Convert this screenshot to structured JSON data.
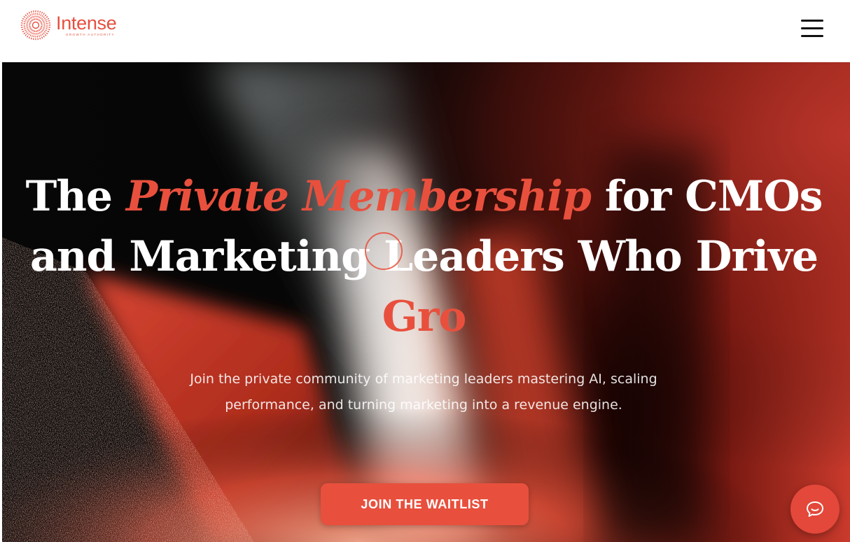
{
  "header": {
    "logo_text": "Intense",
    "logo_subtext": "GROWTH AUTHORITY",
    "logo_icon": "sunburst-logo-icon",
    "menu_icon": "hamburger-menu-icon"
  },
  "hero": {
    "title_part1": "The ",
    "title_accent": "Private Membership",
    "title_part2": " for CMOs and Marketing Leaders Who Drive ",
    "title_accent2": "Gro",
    "subtitle": "Join the private community of marketing leaders mastering AI, scaling performance, and turning marketing into a revenue engine.",
    "cta_label": "JOIN THE WAITLIST"
  },
  "chat": {
    "icon": "chat-bubble-icon"
  },
  "colors": {
    "accent": "#e8503d",
    "hero_dark": "#050505",
    "header_bg": "#ffffff",
    "menu_icon": "#111111"
  }
}
